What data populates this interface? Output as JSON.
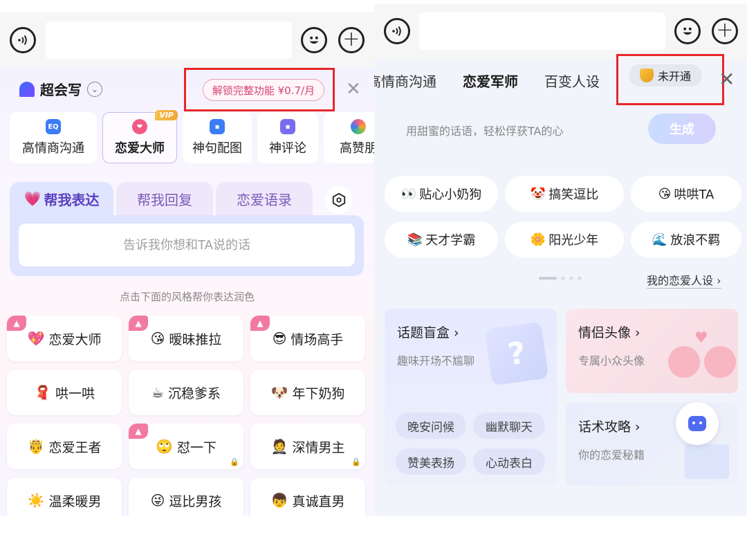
{
  "left": {
    "brand_name": "超会写",
    "unlock_label": "解锁完整功能 ¥0.7/月",
    "close_glyph": "✕",
    "features": [
      {
        "label": "高情商沟通",
        "icon": "eq-icon",
        "icon_text": "EQ",
        "color": "#3c7cf5"
      },
      {
        "label": "恋爱大师",
        "icon": "heart-chat-icon",
        "icon_text": "❤",
        "color": "#f25a86",
        "active": true,
        "badge": "VIP"
      },
      {
        "label": "神句配图",
        "icon": "image-icon",
        "icon_text": "▪",
        "color": "#3c7cf5"
      },
      {
        "label": "神评论",
        "icon": "comment-icon",
        "icon_text": "▪",
        "color": "#7a6cf0"
      },
      {
        "label": "高赞朋",
        "icon": "color-wheel-icon",
        "icon_text": "●",
        "color": "#f0a43a"
      }
    ],
    "tabs": [
      "帮我表达",
      "帮我回复",
      "恋爱语录"
    ],
    "input_placeholder": "告诉我你想和TA说的话",
    "hint": "点击下面的风格帮你表达润色",
    "styles": [
      {
        "emoji": "💖",
        "label": "恋爱大师",
        "hot": true
      },
      {
        "emoji": "😘",
        "label": "暧昧推拉",
        "hot": true
      },
      {
        "emoji": "😎",
        "label": "情场高手",
        "hot": true
      },
      {
        "emoji": "🧣",
        "label": "哄一哄"
      },
      {
        "emoji": "☕",
        "label": "沉稳爹系"
      },
      {
        "emoji": "🐶",
        "label": "年下奶狗"
      },
      {
        "emoji": "🤴",
        "label": "恋爱王者"
      },
      {
        "emoji": "🙄",
        "label": "怼一下",
        "hot": true,
        "locked": true
      },
      {
        "emoji": "🤵",
        "label": "深情男主",
        "locked": true
      },
      {
        "emoji": "☀️",
        "label": "温柔暖男"
      },
      {
        "emoji": "😜",
        "label": "逗比男孩"
      },
      {
        "emoji": "👦",
        "label": "真诚直男"
      }
    ]
  },
  "right": {
    "tabs": [
      "高情商沟通",
      "恋爱军师",
      "百变人设"
    ],
    "not_open_label": "未开通",
    "close_glyph": "✕",
    "input_text": "用甜蜜的话语，轻松俘获TA的心",
    "generate_label": "生成",
    "personas": [
      {
        "emoji": "👀",
        "label": "贴心小奶狗"
      },
      {
        "emoji": "🤡",
        "label": "搞笑逗比"
      },
      {
        "emoji": "😘",
        "label": "哄哄TA"
      },
      {
        "emoji": "📚",
        "label": "天才学霸"
      },
      {
        "emoji": "🌼",
        "label": "阳光少年"
      },
      {
        "emoji": "🌊",
        "label": "放浪不羁"
      }
    ],
    "my_persona_label": "我的恋爱人设",
    "cards": {
      "topic_box": {
        "title": "话题盲盒",
        "subtitle": "趣味开场不尴聊",
        "chips": [
          "晚安问候",
          "幽默聊天",
          "赞美表扬",
          "心动表白"
        ]
      },
      "couple_avatar": {
        "title": "情侣头像",
        "subtitle": "专属小众头像"
      },
      "speech_tips": {
        "title": "话术攻略",
        "subtitle": "你的恋爱秘籍"
      }
    }
  }
}
